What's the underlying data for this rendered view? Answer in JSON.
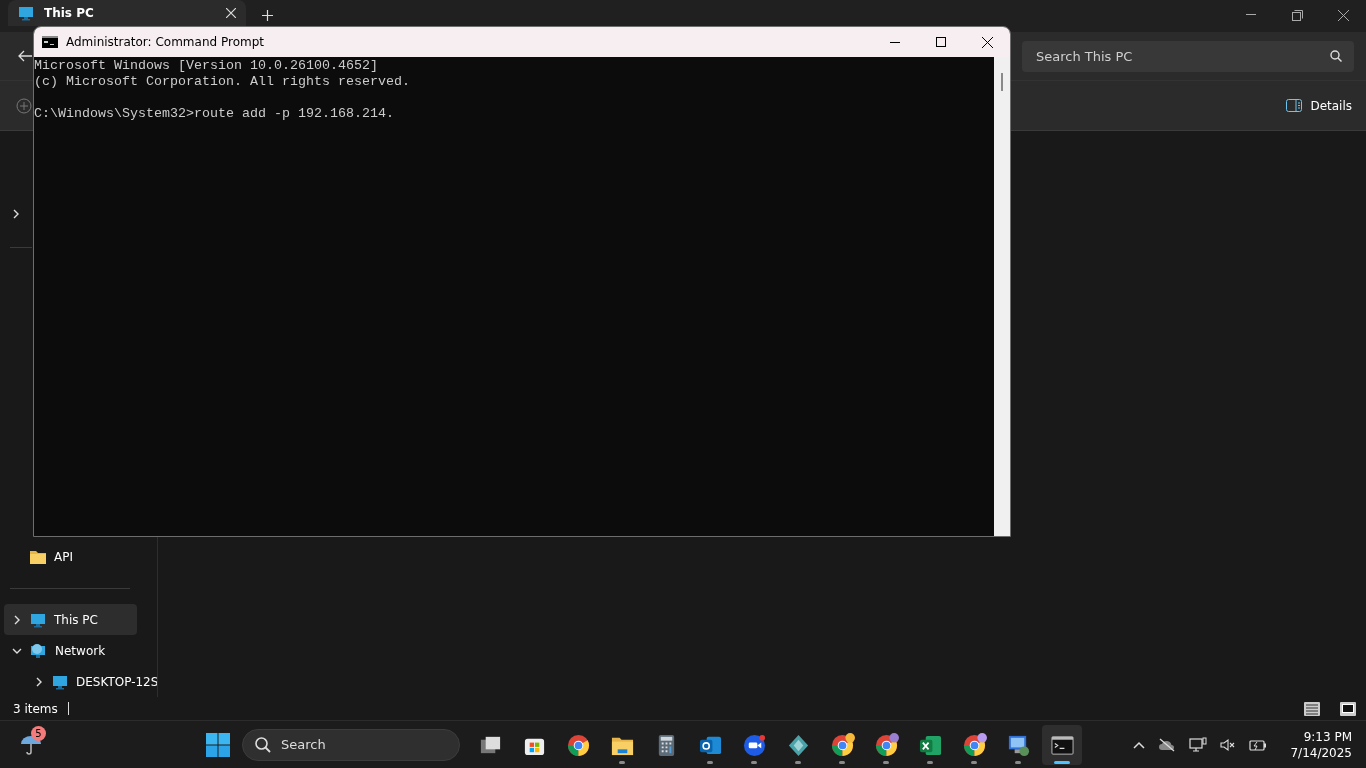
{
  "explorer": {
    "tab_title": "This PC",
    "search": {
      "placeholder": "Search This PC"
    },
    "details_label": "Details",
    "sidebar": [
      {
        "label": "API",
        "kind": "folder",
        "selected": false
      },
      {
        "label": "This PC",
        "kind": "pc",
        "selected": true,
        "expanded": false
      },
      {
        "label": "Network",
        "kind": "network",
        "selected": false,
        "expanded": true,
        "children": [
          {
            "label": "DESKTOP-12S",
            "kind": "pc",
            "selected": false,
            "expanded": false
          }
        ]
      }
    ],
    "status": "3 items"
  },
  "command_prompt": {
    "title": "Administrator: Command Prompt",
    "output": [
      "Microsoft Windows [Version 10.0.26100.4652]",
      "(c) Microsoft Corporation. All rights reserved."
    ],
    "input_line": "C:\\Windows\\System32>route add -p 192.168.214."
  },
  "taskbar": {
    "weather_badge": "5",
    "search": {
      "placeholder": "Search"
    },
    "apps": [
      {
        "kind": "taskview",
        "running": false,
        "selected": false
      },
      {
        "kind": "store",
        "running": false,
        "selected": false
      },
      {
        "kind": "chrome",
        "running": false,
        "selected": false
      },
      {
        "kind": "files",
        "running": true,
        "selected": false
      },
      {
        "kind": "calculator",
        "running": false,
        "selected": false
      },
      {
        "kind": "mail",
        "running": true,
        "selected": false
      },
      {
        "kind": "video",
        "running": true,
        "selected": false
      },
      {
        "kind": "diamond",
        "running": true,
        "selected": false
      },
      {
        "kind": "chrome",
        "color": "#f5b93b",
        "running": true,
        "selected": false
      },
      {
        "kind": "chrome",
        "color": "#9a7fd1",
        "running": true,
        "selected": false
      },
      {
        "kind": "sheet",
        "running": true,
        "selected": false
      },
      {
        "kind": "chrome",
        "color": "#b99cf0",
        "running": true,
        "selected": false
      },
      {
        "kind": "remote",
        "running": true,
        "selected": false
      },
      {
        "kind": "terminal",
        "running": true,
        "selected": true
      }
    ],
    "time": "9:13 PM",
    "date": "7/14/2025"
  }
}
